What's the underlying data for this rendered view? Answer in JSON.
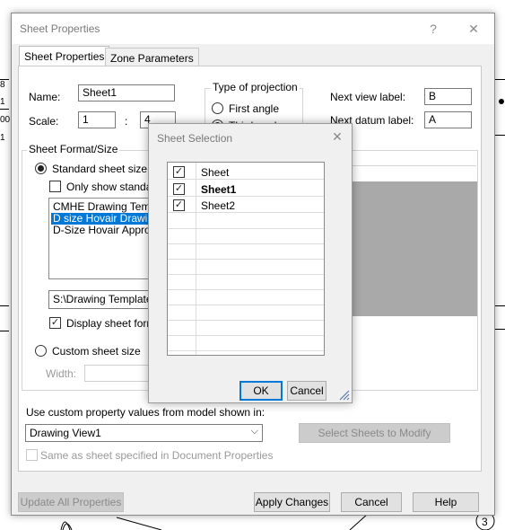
{
  "background": {
    "fragments": [
      "8",
      "1",
      "00",
      "1",
      "3"
    ]
  },
  "dialog": {
    "title": "Sheet Properties",
    "help_glyph": "?",
    "close_glyph": "✕",
    "tabs": [
      {
        "label": "Sheet Properties",
        "active": true
      },
      {
        "label": "Zone Parameters",
        "active": false
      }
    ],
    "name_label": "Name:",
    "name_value": "Sheet1",
    "scale_label": "Scale:",
    "scale_num": "1",
    "scale_sep": ":",
    "scale_den": "4",
    "projection": {
      "title": "Type of projection",
      "options": [
        {
          "label": "First angle",
          "checked": false
        },
        {
          "label": "Third angle",
          "checked": true
        }
      ]
    },
    "next_view_label": "Next view label:",
    "next_view_value": "B",
    "next_datum_label": "Next datum label:",
    "next_datum_value": "A",
    "sheet_format": {
      "title": "Sheet Format/Size",
      "standard_label": "Standard sheet size",
      "standard_checked": true,
      "only_show_label": "Only show standar",
      "only_show_checked": false,
      "list_items": [
        {
          "label": "CMHE Drawing Temp",
          "selected": false
        },
        {
          "label": "D size Hovair Drawin",
          "selected": true
        },
        {
          "label": "D-Size Hovair Approv",
          "selected": false
        }
      ],
      "path_value": "S:\\Drawing Template",
      "display_format_label": "Display sheet forma",
      "display_format_checked": true,
      "custom_label": "Custom sheet size",
      "custom_checked": false,
      "width_label": "Width:"
    },
    "use_custom_label": "Use custom property values from model shown in:",
    "model_combo_value": "Drawing View1",
    "select_sheets_button": "Select Sheets to Modify",
    "same_as_label": "Same as sheet specified in Document Properties",
    "same_as_checked": false,
    "update_all_button": "Update All Properties",
    "apply_button": "Apply Changes",
    "cancel_button": "Cancel",
    "help_button": "Help"
  },
  "popup": {
    "title": "Sheet Selection",
    "close_glyph": "✕",
    "rows": [
      {
        "label": "Sheet",
        "checked": true,
        "bold": false
      },
      {
        "label": "Sheet1",
        "checked": true,
        "bold": true
      },
      {
        "label": "Sheet2",
        "checked": true,
        "bold": false
      }
    ],
    "ok_button": "OK",
    "cancel_button": "Cancel"
  }
}
